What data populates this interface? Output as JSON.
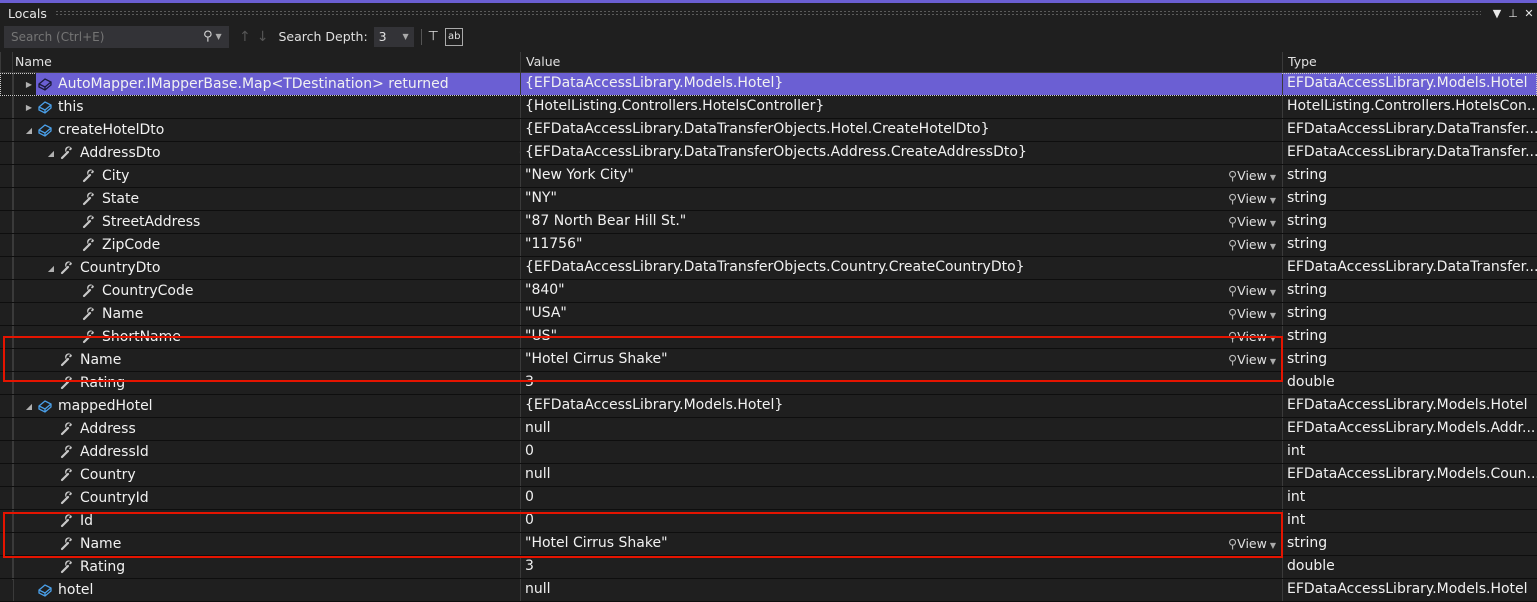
{
  "window": {
    "title": "Locals",
    "controls": [
      "dropdown-icon",
      "pin-icon",
      "close-icon"
    ]
  },
  "toolbar": {
    "search_placeholder": "Search (Ctrl+E)",
    "search_icon": "search-icon",
    "search_depth_label": "Search Depth:",
    "search_depth_value": "3"
  },
  "columns": {
    "name": "Name",
    "value": "Value",
    "type": "Type"
  },
  "rows": [
    {
      "level": 0,
      "expander": "collapsed",
      "icon": "return-value-icon",
      "name": "AutoMapper.IMapperBase.Map<TDestination> returned",
      "value": "{EFDataAccessLibrary.Models.Hotel}",
      "type": "EFDataAccessLibrary.Models.Hotel",
      "selected": true,
      "view": false
    },
    {
      "level": 0,
      "expander": "collapsed",
      "icon": "object-icon",
      "name": "this",
      "value": "{HotelListing.Controllers.HotelsController}",
      "type": "HotelListing.Controllers.HotelsCon...",
      "view": false
    },
    {
      "level": 0,
      "expander": "expanded",
      "icon": "object-icon",
      "name": "createHotelDto",
      "value": "{EFDataAccessLibrary.DataTransferObjects.Hotel.CreateHotelDto}",
      "type": "EFDataAccessLibrary.DataTransfer...",
      "view": false
    },
    {
      "level": 1,
      "expander": "expanded",
      "icon": "property-icon",
      "name": "AddressDto",
      "value": "{EFDataAccessLibrary.DataTransferObjects.Address.CreateAddressDto}",
      "type": "EFDataAccessLibrary.DataTransfer...",
      "view": false,
      "pin": true
    },
    {
      "level": 2,
      "expander": "none",
      "icon": "property-icon",
      "name": "City",
      "value": "\"New York City\"",
      "type": "string",
      "view": true
    },
    {
      "level": 2,
      "expander": "none",
      "icon": "property-icon",
      "name": "State",
      "value": "\"NY\"",
      "type": "string",
      "view": true
    },
    {
      "level": 2,
      "expander": "none",
      "icon": "property-icon",
      "name": "StreetAddress",
      "value": "\"87 North Bear Hill St.\"",
      "type": "string",
      "view": true
    },
    {
      "level": 2,
      "expander": "none",
      "icon": "property-icon",
      "name": "ZipCode",
      "value": "\"11756\"",
      "type": "string",
      "view": true
    },
    {
      "level": 1,
      "expander": "expanded",
      "icon": "property-icon",
      "name": "CountryDto",
      "value": "{EFDataAccessLibrary.DataTransferObjects.Country.CreateCountryDto}",
      "type": "EFDataAccessLibrary.DataTransfer...",
      "view": false
    },
    {
      "level": 2,
      "expander": "none",
      "icon": "property-icon",
      "name": "CountryCode",
      "value": "\"840\"",
      "type": "string",
      "view": true
    },
    {
      "level": 2,
      "expander": "none",
      "icon": "property-icon",
      "name": "Name",
      "value": "\"USA\"",
      "type": "string",
      "view": true
    },
    {
      "level": 2,
      "expander": "none",
      "icon": "property-icon",
      "name": "ShortName",
      "value": "\"US\"",
      "type": "string",
      "view": true
    },
    {
      "level": 1,
      "expander": "none",
      "icon": "property-icon",
      "name": "Name",
      "value": "\"Hotel Cirrus Shake\"",
      "type": "string",
      "view": true
    },
    {
      "level": 1,
      "expander": "none",
      "icon": "property-icon",
      "name": "Rating",
      "value": "3",
      "type": "double",
      "view": false
    },
    {
      "level": 0,
      "expander": "expanded",
      "icon": "object-icon",
      "name": "mappedHotel",
      "value": "{EFDataAccessLibrary.Models.Hotel}",
      "type": "EFDataAccessLibrary.Models.Hotel",
      "view": false
    },
    {
      "level": 1,
      "expander": "none",
      "icon": "property-icon",
      "name": "Address",
      "value": "null",
      "type": "EFDataAccessLibrary.Models.Addr...",
      "view": false
    },
    {
      "level": 1,
      "expander": "none",
      "icon": "property-icon",
      "name": "AddressId",
      "value": "0",
      "type": "int",
      "view": false
    },
    {
      "level": 1,
      "expander": "none",
      "icon": "property-icon",
      "name": "Country",
      "value": "null",
      "type": "EFDataAccessLibrary.Models.Coun...",
      "view": false
    },
    {
      "level": 1,
      "expander": "none",
      "icon": "property-icon",
      "name": "CountryId",
      "value": "0",
      "type": "int",
      "view": false
    },
    {
      "level": 1,
      "expander": "none",
      "icon": "property-icon",
      "name": "Id",
      "value": "0",
      "type": "int",
      "view": false
    },
    {
      "level": 1,
      "expander": "none",
      "icon": "property-icon",
      "name": "Name",
      "value": "\"Hotel Cirrus Shake\"",
      "type": "string",
      "view": true
    },
    {
      "level": 1,
      "expander": "none",
      "icon": "property-icon",
      "name": "Rating",
      "value": "3",
      "type": "double",
      "view": false
    },
    {
      "level": 0,
      "expander": "none",
      "icon": "object-icon",
      "name": "hotel",
      "value": "null",
      "type": "EFDataAccessLibrary.Models.Hotel",
      "view": false
    }
  ],
  "view_label": "View",
  "highlights": [
    {
      "rows": [
        12,
        13
      ],
      "color": "#e51400"
    },
    {
      "rows": [
        20,
        21
      ],
      "color": "#e51400"
    }
  ],
  "colors": {
    "accent": "#6b5fd3",
    "background": "#1f1f1f",
    "highlight": "#e51400",
    "object_icon": "#4a9fe8"
  }
}
